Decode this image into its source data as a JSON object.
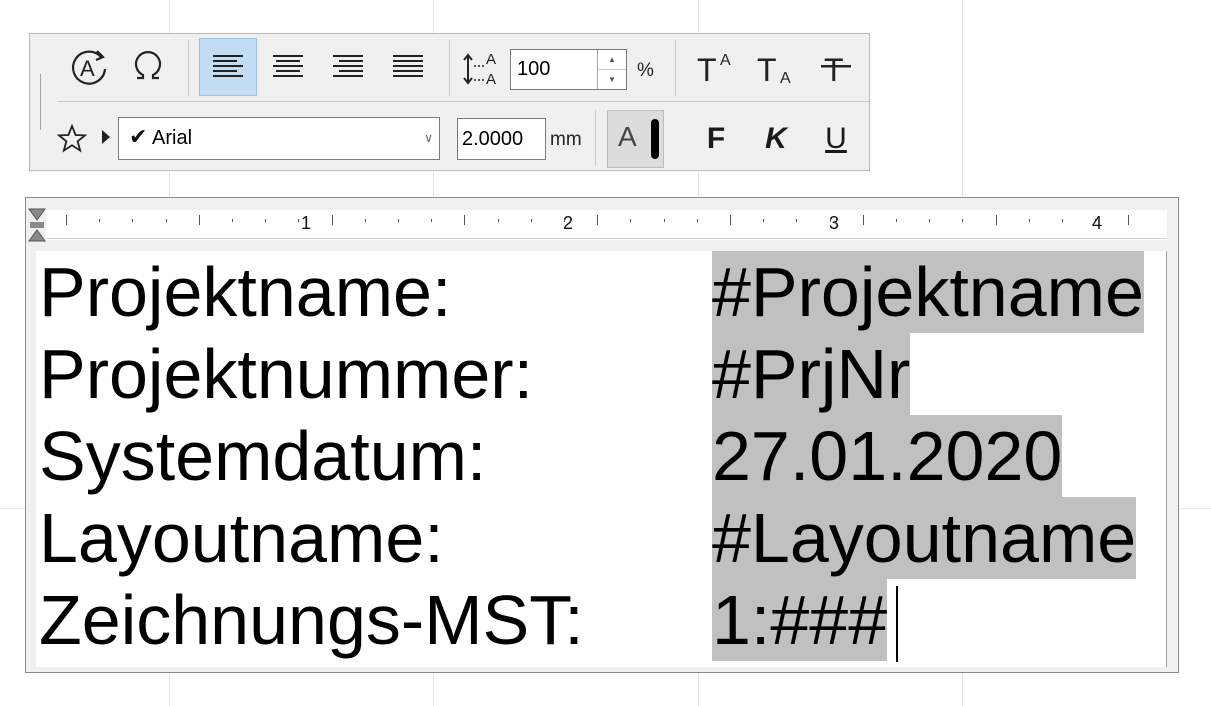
{
  "toolbar": {
    "row1": {
      "line_spacing_value": "100",
      "line_spacing_unit": "%"
    },
    "row2": {
      "font_name": "Arial",
      "font_size_value": "2.0000",
      "font_size_unit": "mm",
      "color_glyph": "A",
      "bold_label": "F",
      "italic_label": "K",
      "underline_label": "U"
    }
  },
  "ruler": {
    "numbers": [
      "1",
      "2",
      "3",
      "4"
    ]
  },
  "editor": {
    "lines": [
      {
        "label": "Projektname:",
        "value": "#Projektname"
      },
      {
        "label": "Projektnummer:",
        "value": "#PrjNr"
      },
      {
        "label": "Systemdatum:",
        "value": "27.01.2020"
      },
      {
        "label": "Layoutname:",
        "value": "#Layoutname"
      },
      {
        "label": "Zeichnungs-MST:",
        "value": "1:###"
      }
    ]
  }
}
